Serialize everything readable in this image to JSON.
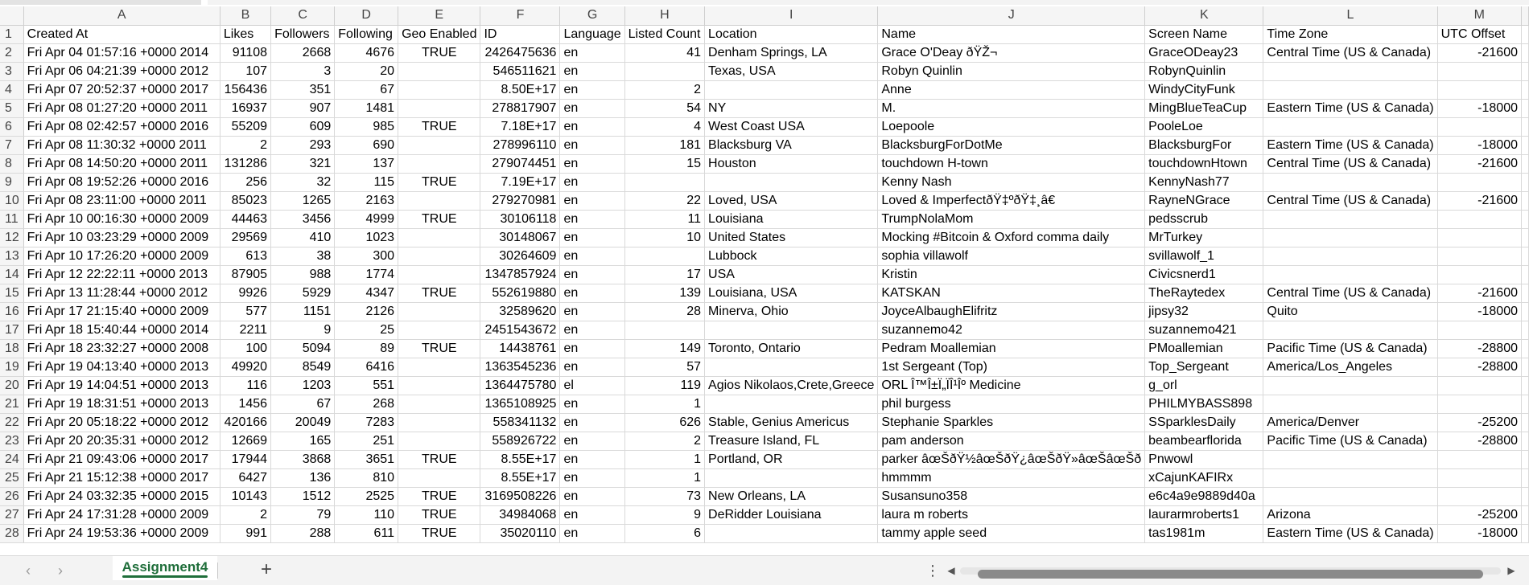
{
  "columns": [
    "A",
    "B",
    "C",
    "D",
    "E",
    "F",
    "G",
    "H",
    "I",
    "J",
    "K",
    "L",
    "M"
  ],
  "headers": [
    "Created At",
    "Likes",
    "Followers",
    "Following",
    "Geo Enabled",
    "ID",
    "Language",
    "Listed Count",
    "Location",
    "Name",
    "Screen Name",
    "Time Zone",
    "UTC Offset"
  ],
  "rows": [
    [
      "Fri Apr 04 01:57:16 +0000 2014",
      "91108",
      "2668",
      "4676",
      "TRUE",
      "2426475636",
      "en",
      "41",
      "Denham Springs, LA",
      "Grace O'Deay ðŸŽ¬",
      "GraceODeay23",
      "Central Time (US & Canada)",
      "-21600"
    ],
    [
      "Fri Apr 06 04:21:39 +0000 2012",
      "107",
      "3",
      "20",
      "",
      "546511621",
      "en",
      "",
      "Texas, USA",
      "Robyn Quinlin",
      "RobynQuinlin",
      "",
      ""
    ],
    [
      "Fri Apr 07 20:52:37 +0000 2017",
      "156436",
      "351",
      "67",
      "",
      "8.50E+17",
      "en",
      "2",
      "",
      "Anne",
      "WindyCityFunk",
      "",
      ""
    ],
    [
      "Fri Apr 08 01:27:20 +0000 2011",
      "16937",
      "907",
      "1481",
      "",
      "278817907",
      "en",
      "54",
      "NY",
      "M.",
      "MingBlueTeaCup",
      "Eastern Time (US & Canada)",
      "-18000"
    ],
    [
      "Fri Apr 08 02:42:57 +0000 2016",
      "55209",
      "609",
      "985",
      "TRUE",
      "7.18E+17",
      "en",
      "4",
      "West Coast USA",
      "Loepoole",
      "PooleLoe",
      "",
      ""
    ],
    [
      "Fri Apr 08 11:30:32 +0000 2011",
      "2",
      "293",
      "690",
      "",
      "278996110",
      "en",
      "181",
      "Blacksburg VA",
      "BlacksburgForDotMe",
      "BlacksburgFor",
      "Eastern Time (US & Canada)",
      "-18000"
    ],
    [
      "Fri Apr 08 14:50:20 +0000 2011",
      "131286",
      "321",
      "137",
      "",
      "279074451",
      "en",
      "15",
      "Houston",
      "touchdown H-town",
      "touchdownHtown",
      "Central Time (US & Canada)",
      "-21600"
    ],
    [
      "Fri Apr 08 19:52:26 +0000 2016",
      "256",
      "32",
      "115",
      "TRUE",
      "7.19E+17",
      "en",
      "",
      "",
      "Kenny Nash",
      "KennyNash77",
      "",
      ""
    ],
    [
      "Fri Apr 08 23:11:00 +0000 2011",
      "85023",
      "1265",
      "2163",
      "",
      "279270981",
      "en",
      "22",
      "Loved,  USA",
      "Loved & ImperfectðŸ‡ºðŸ‡¸â€",
      "RayneNGrace",
      "Central Time (US & Canada)",
      "-21600"
    ],
    [
      "Fri Apr 10 00:16:30 +0000 2009",
      "44463",
      "3456",
      "4999",
      "TRUE",
      "30106118",
      "en",
      "11",
      "Louisiana",
      "TrumpNolaMom",
      "pedsscrub",
      "",
      ""
    ],
    [
      "Fri Apr 10 03:23:29 +0000 2009",
      "29569",
      "410",
      "1023",
      "",
      "30148067",
      "en",
      "10",
      "United States",
      "Mocking #Bitcoin & Oxford comma daily",
      "MrTurkey",
      "",
      ""
    ],
    [
      "Fri Apr 10 17:26:20 +0000 2009",
      "613",
      "38",
      "300",
      "",
      "30264609",
      "en",
      "",
      "Lubbock",
      "sophia villawolf",
      "svillawolf_1",
      "",
      ""
    ],
    [
      "Fri Apr 12 22:22:11 +0000 2013",
      "87905",
      "988",
      "1774",
      "",
      "1347857924",
      "en",
      "17",
      "USA",
      "Kristin",
      "Civicsnerd1",
      "",
      ""
    ],
    [
      "Fri Apr 13 11:28:44 +0000 2012",
      "9926",
      "5929",
      "4347",
      "TRUE",
      "552619880",
      "en",
      "139",
      "Louisiana, USA",
      "KATSKAN",
      "TheRaytedex",
      "Central Time (US & Canada)",
      "-21600"
    ],
    [
      "Fri Apr 17 21:15:40 +0000 2009",
      "577",
      "1151",
      "2126",
      "",
      "32589620",
      "en",
      "28",
      "Minerva, Ohio",
      "JoyceAlbaughElifritz",
      "jipsy32",
      "Quito",
      "-18000"
    ],
    [
      "Fri Apr 18 15:40:44 +0000 2014",
      "2211",
      "9",
      "25",
      "",
      "2451543672",
      "en",
      "",
      "",
      "suzannemo42",
      "suzannemo421",
      "",
      ""
    ],
    [
      "Fri Apr 18 23:32:27 +0000 2008",
      "100",
      "5094",
      "89",
      "TRUE",
      "14438761",
      "en",
      "149",
      "Toronto, Ontario",
      "Pedram Moallemian",
      "PMoallemian",
      "Pacific Time (US & Canada)",
      "-28800"
    ],
    [
      "Fri Apr 19 04:13:40 +0000 2013",
      "49920",
      "8549",
      "6416",
      "",
      "1363545236",
      "en",
      "57",
      "",
      "1st Sergeant (Top)",
      "Top_Sergeant",
      "America/Los_Angeles",
      "-28800"
    ],
    [
      "Fri Apr 19 14:04:51 +0000 2013",
      "116",
      "1203",
      "551",
      "",
      "1364475780",
      "el",
      "119",
      "Agios Nikolaos,Crete,Greece",
      "ORL Î™Î±Ï„ÏÎ¹Îº Medicine",
      "g_orl",
      "",
      ""
    ],
    [
      "Fri Apr 19 18:31:51 +0000 2013",
      "1456",
      "67",
      "268",
      "",
      "1365108925",
      "en",
      "1",
      "",
      "phil burgess",
      "PHILMYBASS898",
      "",
      ""
    ],
    [
      "Fri Apr 20 05:18:22 +0000 2012",
      "420166",
      "20049",
      "7283",
      "",
      "558341132",
      "en",
      "626",
      "Stable, Genius Americus",
      "Stephanie Sparkles",
      "SSparklesDaily",
      "America/Denver",
      "-25200"
    ],
    [
      "Fri Apr 20 20:35:31 +0000 2012",
      "12669",
      "165",
      "251",
      "",
      "558926722",
      "en",
      "2",
      "Treasure Island, FL",
      "pam anderson",
      "beambearflorida",
      "Pacific Time (US & Canada)",
      "-28800"
    ],
    [
      "Fri Apr 21 09:43:06 +0000 2017",
      "17944",
      "3868",
      "3651",
      "TRUE",
      "8.55E+17",
      "en",
      "1",
      "Portland, OR",
      "parker  âœŠðŸ½âœŠðŸ¿âœŠðŸ»âœŠâœŠð",
      "Pnwowl",
      "",
      ""
    ],
    [
      "Fri Apr 21 15:12:38 +0000 2017",
      "6427",
      "136",
      "810",
      "",
      "8.55E+17",
      "en",
      "1",
      "",
      "hmmmm",
      "xCajunKAFIRx",
      "",
      ""
    ],
    [
      "Fri Apr 24 03:32:35 +0000 2015",
      "10143",
      "1512",
      "2525",
      "TRUE",
      "3169508226",
      "en",
      "73",
      "New Orleans, LA",
      "Susansuno358",
      "e6c4a9e9889d40a",
      "",
      ""
    ],
    [
      "Fri Apr 24 17:31:28 +0000 2009",
      "2",
      "79",
      "110",
      "TRUE",
      "34984068",
      "en",
      "9",
      "DeRidder Louisiana",
      "laura m roberts",
      "laurarmroberts1",
      "Arizona",
      "-25200"
    ],
    [
      "Fri Apr 24 19:53:36 +0000 2009",
      "991",
      "288",
      "611",
      "TRUE",
      "35020110",
      "en",
      "6",
      "",
      "tammy apple seed",
      "tas1981m",
      "Eastern Time (US & Canada)",
      "-18000"
    ]
  ],
  "sheet_tab": "Assignment4",
  "nav": {
    "prev": "‹",
    "next": "›",
    "add": "+",
    "more": "⋮",
    "scroll_left": "◀",
    "scroll_right": "▶"
  }
}
